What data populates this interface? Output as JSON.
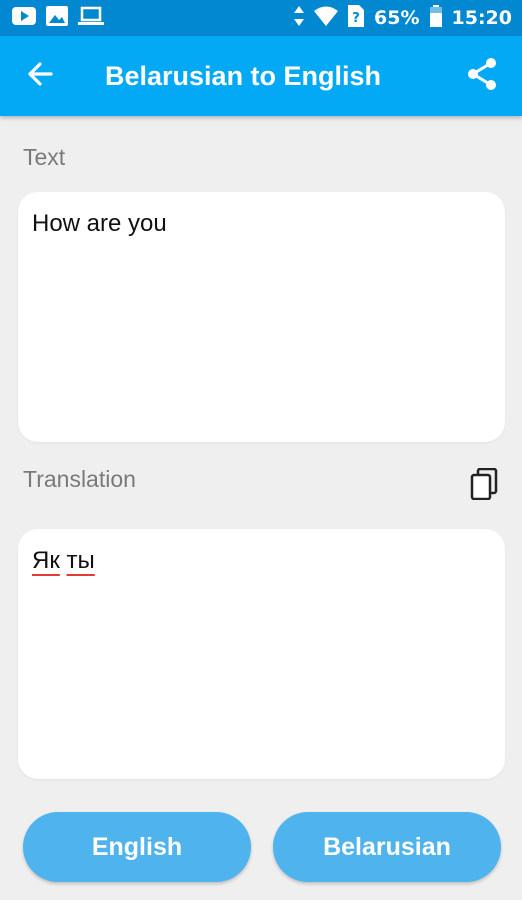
{
  "status_bar": {
    "battery": "65%",
    "time": "15:20",
    "icons": [
      "youtube-icon",
      "image-icon",
      "laptop-icon",
      "data-arrows-icon",
      "wifi-icon",
      "sim-icon",
      "battery-icon"
    ]
  },
  "app_bar": {
    "title": "Belarusian to English",
    "back_icon": "arrow-back-icon",
    "share_icon": "share-icon"
  },
  "input": {
    "label": "Text",
    "value": "How are you"
  },
  "output": {
    "label": "Translation",
    "words": [
      "Як",
      "ты"
    ],
    "copy_icon": "copy-icon"
  },
  "buttons": {
    "left_label": "English",
    "right_label": "Belarusian"
  },
  "colors": {
    "status_bar": "#0288d1",
    "app_bar": "#03a9f4",
    "button": "#4fb3ee",
    "background": "#efefef"
  }
}
